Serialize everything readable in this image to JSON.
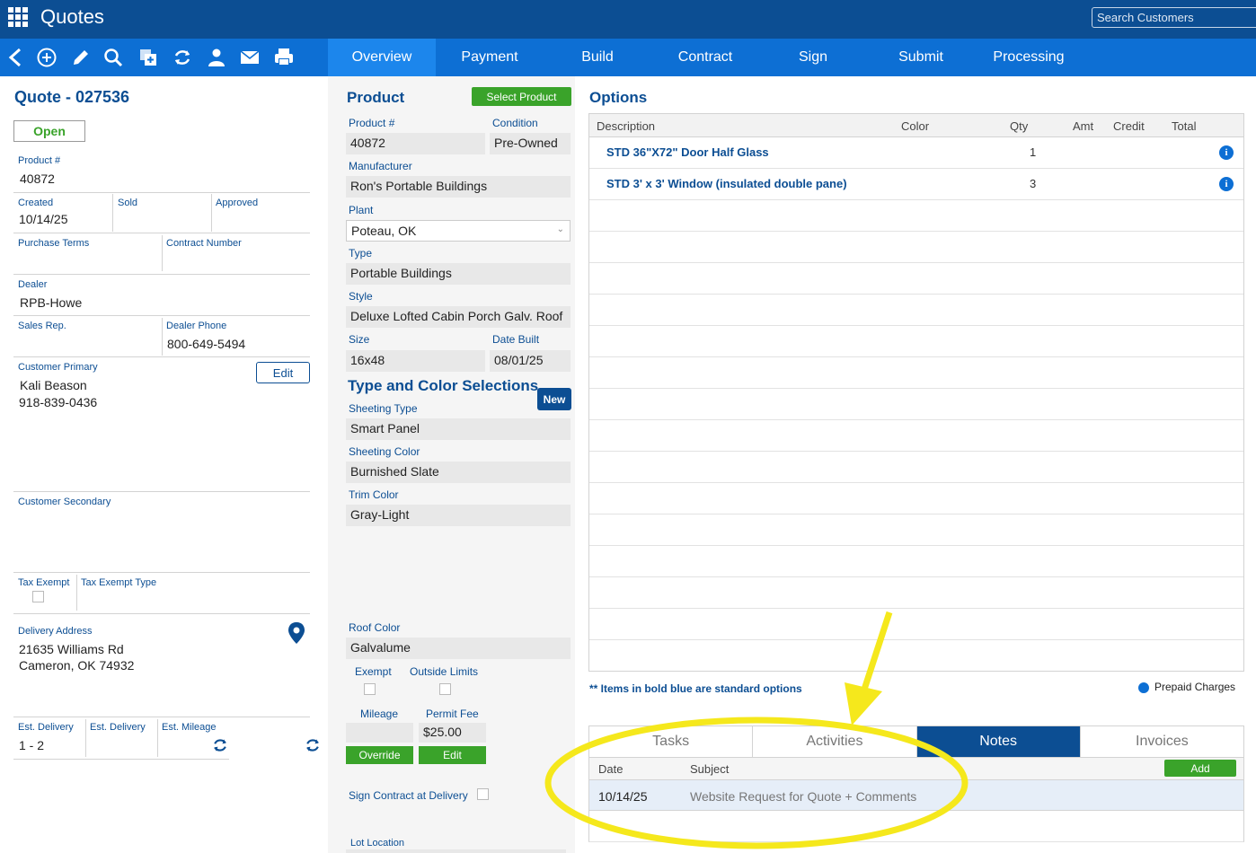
{
  "header": {
    "app_title": "Quotes",
    "search_placeholder": "Search Customers"
  },
  "tabs": [
    "Overview",
    "Payment",
    "Build",
    "Contract",
    "Sign",
    "Submit",
    "Processing"
  ],
  "active_tab": "Overview",
  "quote": {
    "title": "Quote - 027536",
    "status": "Open",
    "product_no_label": "Product #",
    "product_no": "40872",
    "created_label": "Created",
    "created": "10/14/25",
    "sold_label": "Sold",
    "approved_label": "Approved",
    "purchase_terms_label": "Purchase Terms",
    "contract_number_label": "Contract Number",
    "dealer_label": "Dealer",
    "dealer": "RPB-Howe",
    "sales_rep_label": "Sales Rep.",
    "dealer_phone_label": "Dealer Phone",
    "dealer_phone": "800-649-5494",
    "customer_primary_label": "Customer Primary",
    "customer_name": "Kali Beason",
    "customer_phone": "918-839-0436",
    "edit_label": "Edit",
    "customer_secondary_label": "Customer Secondary",
    "tax_exempt_label": "Tax Exempt",
    "tax_exempt_type_label": "Tax Exempt Type",
    "delivery_address_label": "Delivery Address",
    "address_line1": "21635 Williams Rd",
    "address_line2": "Cameron, OK 74932",
    "est_delivery_label": "Est. Delivery",
    "est_delivery": "1 - 2",
    "est_delivery2_label": "Est. Delivery",
    "est_mileage_label": "Est. Mileage"
  },
  "product": {
    "title": "Product",
    "select_button": "Select Product",
    "product_no_label": "Product #",
    "product_no": "40872",
    "condition_label": "Condition",
    "condition": "Pre-Owned",
    "manufacturer_label": "Manufacturer",
    "manufacturer": "Ron's Portable Buildings",
    "plant_label": "Plant",
    "plant": "Poteau, OK",
    "type_label": "Type",
    "type": "Portable Buildings",
    "style_label": "Style",
    "style": "Deluxe Lofted Cabin Porch Galv. Roof",
    "size_label": "Size",
    "size": "16x48",
    "date_built_label": "Date Built",
    "date_built": "08/01/25"
  },
  "type_color": {
    "title": "Type and Color Selections",
    "new_button": "New",
    "sheeting_type_label": "Sheeting Type",
    "sheeting_type": "Smart Panel",
    "sheeting_color_label": "Sheeting Color",
    "sheeting_color": "Burnished Slate",
    "trim_color_label": "Trim Color",
    "trim_color": "Gray-Light",
    "roof_color_label": "Roof Color",
    "roof_color": "Galvalume",
    "exempt_label": "Exempt",
    "outside_limits_label": "Outside Limits",
    "mileage_label": "Mileage",
    "permit_fee_label": "Permit Fee",
    "permit_fee": "$25.00",
    "override_button": "Override",
    "edit_button": "Edit",
    "sign_contract_label": "Sign Contract at Delivery",
    "lot_location_label": "Lot Location"
  },
  "options": {
    "title": "Options",
    "columns": [
      "Description",
      "Color",
      "Qty",
      "Amt",
      "Credit",
      "Total"
    ],
    "rows": [
      {
        "description": "STD 36\"X72\"  Door Half Glass",
        "qty": "1"
      },
      {
        "description": "STD 3' x 3' Window (insulated double pane)",
        "qty": "3"
      }
    ],
    "footnote": "** Items in bold blue are standard options",
    "prepaid_label": "Prepaid Charges"
  },
  "bottom_tabs": [
    "Tasks",
    "Activities",
    "Notes",
    "Invoices"
  ],
  "active_bottom_tab": "Notes",
  "notes": {
    "date_col": "Date",
    "subject_col": "Subject",
    "add_button": "Add",
    "rows": [
      {
        "date": "10/14/25",
        "subject": "Website Request for Quote + Comments"
      }
    ]
  },
  "colors": {
    "header": "#0c4e93",
    "navbar": "#0d6fd4",
    "accent_green": "#3aa32a",
    "highlight_yellow": "#f5e81c"
  }
}
